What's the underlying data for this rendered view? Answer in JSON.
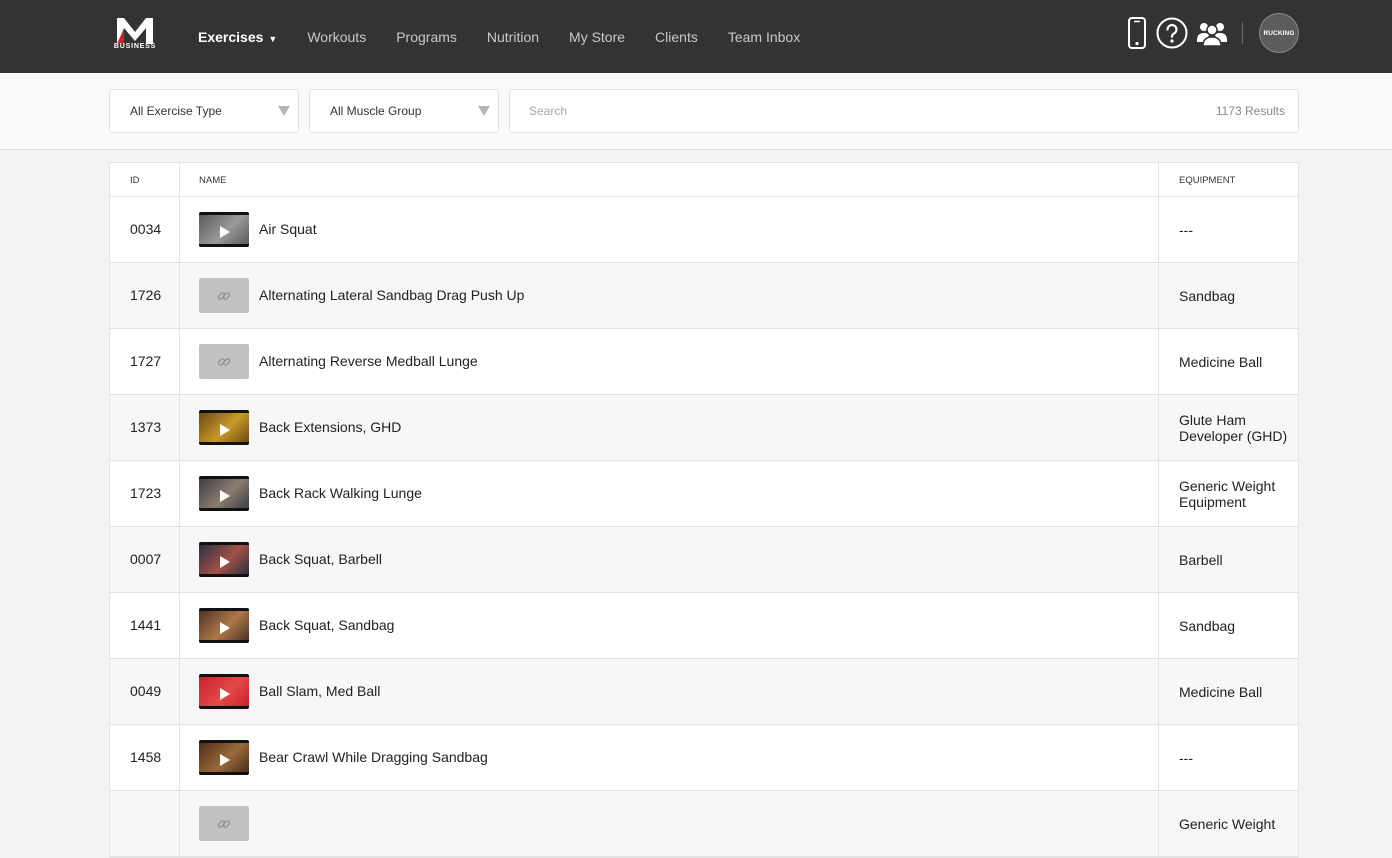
{
  "brand": {
    "logo_letter": "M",
    "logo_subtitle": "BUSINESS"
  },
  "nav": {
    "items": [
      {
        "label": "Exercises",
        "active": true,
        "caret": "▼"
      },
      {
        "label": "Workouts"
      },
      {
        "label": "Programs"
      },
      {
        "label": "Nutrition"
      },
      {
        "label": "My Store"
      },
      {
        "label": "Clients"
      },
      {
        "label": "Team Inbox"
      }
    ],
    "icons": [
      "phone-icon",
      "help-icon",
      "team-icon"
    ],
    "avatar_text": "RUCKING"
  },
  "filters": {
    "exercise_type": "All Exercise Type",
    "muscle_group": "All Muscle Group",
    "search_placeholder": "Search",
    "results": "1173 Results"
  },
  "table": {
    "headers": {
      "id": "ID",
      "name": "NAME",
      "equipment": "EQUIPMENT"
    },
    "rows": [
      {
        "id": "0034",
        "name": "Air Squat",
        "equipment": "---",
        "thumb": "video",
        "colors": [
          "#5a5a5a",
          "#9a9a9a"
        ]
      },
      {
        "id": "1726",
        "name": "Alternating Lateral Sandbag Drag Push Up",
        "equipment": "Sandbag",
        "thumb": "none"
      },
      {
        "id": "1727",
        "name": "Alternating Reverse Medball Lunge",
        "equipment": "Medicine Ball",
        "thumb": "none"
      },
      {
        "id": "1373",
        "name": "Back Extensions, GHD",
        "equipment": "Glute Ham Developer (GHD)",
        "thumb": "video",
        "colors": [
          "#6b4a10",
          "#c89a2a"
        ]
      },
      {
        "id": "1723",
        "name": "Back Rack Walking Lunge",
        "equipment": "Generic Weight Equipment",
        "thumb": "video",
        "colors": [
          "#3d3d44",
          "#8c7e6e"
        ]
      },
      {
        "id": "0007",
        "name": "Back Squat, Barbell",
        "equipment": "Barbell",
        "thumb": "video",
        "colors": [
          "#2a3242",
          "#a35046"
        ]
      },
      {
        "id": "1441",
        "name": "Back Squat, Sandbag",
        "equipment": "Sandbag",
        "thumb": "video",
        "colors": [
          "#4a3222",
          "#b0784a"
        ]
      },
      {
        "id": "0049",
        "name": "Ball Slam, Med Ball",
        "equipment": "Medicine Ball",
        "thumb": "video",
        "colors": [
          "#c8202a",
          "#e24a4a"
        ]
      },
      {
        "id": "1458",
        "name": "Bear Crawl While Dragging Sandbag",
        "equipment": "---",
        "thumb": "video",
        "colors": [
          "#4a2e18",
          "#9a6a3a"
        ]
      },
      {
        "id": "",
        "name": "",
        "equipment": "Generic Weight",
        "thumb": "none"
      }
    ]
  }
}
